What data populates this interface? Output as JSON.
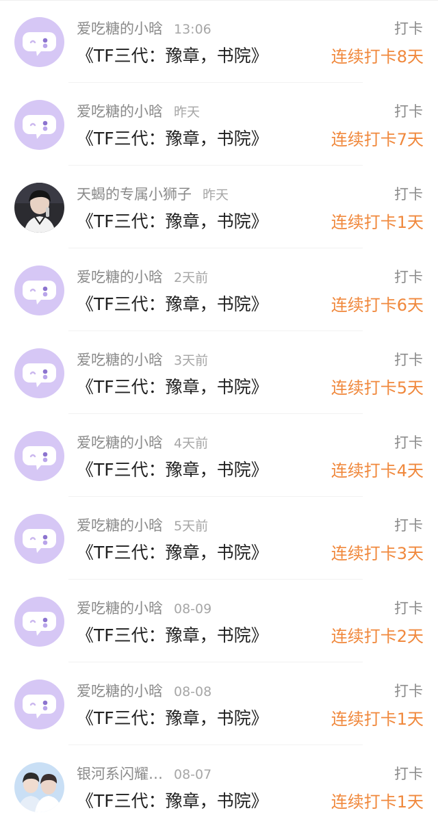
{
  "items": [
    {
      "name": "爱吃糖的小晗",
      "time": "13:06",
      "title": "《TF三代：豫章，书院》",
      "tag": "打卡",
      "streak": "连续打卡8天",
      "avatar": "bubble-icon"
    },
    {
      "name": "爱吃糖的小晗",
      "time": "昨天",
      "title": "《TF三代：豫章，书院》",
      "tag": "打卡",
      "streak": "连续打卡7天",
      "avatar": "bubble-icon"
    },
    {
      "name": "天蝎的专属小狮子",
      "time": "昨天",
      "title": "《TF三代：豫章，书院》",
      "tag": "打卡",
      "streak": "连续打卡1天",
      "avatar": "photo-person"
    },
    {
      "name": "爱吃糖的小晗",
      "time": "2天前",
      "title": "《TF三代：豫章，书院》",
      "tag": "打卡",
      "streak": "连续打卡6天",
      "avatar": "bubble-icon"
    },
    {
      "name": "爱吃糖的小晗",
      "time": "3天前",
      "title": "《TF三代：豫章，书院》",
      "tag": "打卡",
      "streak": "连续打卡5天",
      "avatar": "bubble-icon"
    },
    {
      "name": "爱吃糖的小晗",
      "time": "4天前",
      "title": "《TF三代：豫章，书院》",
      "tag": "打卡",
      "streak": "连续打卡4天",
      "avatar": "bubble-icon"
    },
    {
      "name": "爱吃糖的小晗",
      "time": "5天前",
      "title": "《TF三代：豫章，书院》",
      "tag": "打卡",
      "streak": "连续打卡3天",
      "avatar": "bubble-icon"
    },
    {
      "name": "爱吃糖的小晗",
      "time": "08-09",
      "title": "《TF三代：豫章，书院》",
      "tag": "打卡",
      "streak": "连续打卡2天",
      "avatar": "bubble-icon"
    },
    {
      "name": "爱吃糖的小晗",
      "time": "08-08",
      "title": "《TF三代：豫章，书院》",
      "tag": "打卡",
      "streak": "连续打卡1天",
      "avatar": "bubble-icon"
    },
    {
      "name": "银河系闪耀…",
      "time": "08-07",
      "title": "《TF三代：豫章，书院》",
      "tag": "打卡",
      "streak": "连续打卡1天",
      "avatar": "photo-duo"
    }
  ],
  "colors": {
    "bubble_bg": "#d6c7f5",
    "streak": "#f0883c",
    "meta": "#8a8a8a"
  }
}
